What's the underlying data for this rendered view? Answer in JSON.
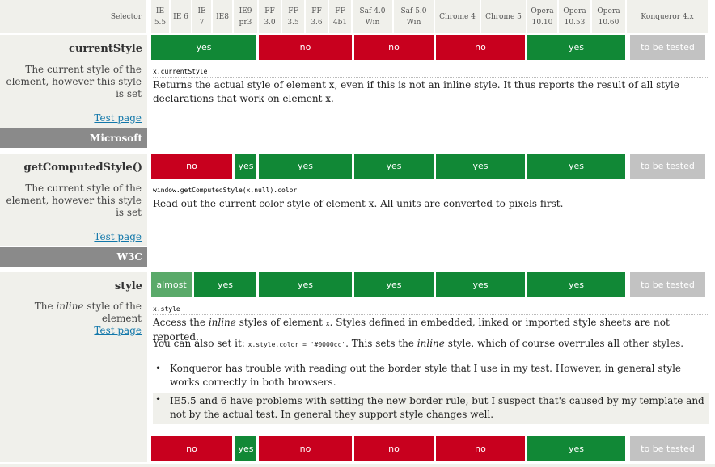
{
  "header": {
    "selector": "Selector",
    "columns": [
      "IE\n5.5",
      "IE 6",
      "IE\n7",
      "IE8",
      "IE9\npr3",
      "FF\n3.0",
      "FF\n3.5",
      "FF\n3.6",
      "FF\n4b1",
      "Saf 4.0\nWin",
      "Saf 5.0\nWin",
      "Chrome 4",
      "Chrome 5",
      "Opera\n10.10",
      "Opera\n10.53",
      "Opera\n10.60",
      "Konqueror 4.x"
    ]
  },
  "rows": {
    "currentStyle": {
      "name": "currentStyle",
      "desc": "The current style of the element, however this style is set",
      "test": "Test page",
      "code": "x.currentStyle",
      "text": "Returns the actual style of element x, even if this is not an inline style. It thus reports the result of all style declarations that work on element x.",
      "results": [
        "yes",
        "no",
        "no",
        "no",
        "yes",
        "to be tested"
      ]
    },
    "group1": "Microsoft",
    "getComputedStyle": {
      "name": "getComputedStyle()",
      "desc": "The current style of the element, however this style is set",
      "test": "Test page",
      "code": "window.getComputedStyle(x,null).color",
      "text": "Read out the current color style of element x. All units are converted to pixels first.",
      "results": [
        "no",
        "yes",
        "yes",
        "yes",
        "yes",
        "yes",
        "to be tested"
      ]
    },
    "group2": "W3C",
    "style": {
      "name": "style",
      "desc_pre": "The ",
      "desc_em": "inline",
      "desc_post": " style of the element",
      "test": "Test page",
      "code": "x.style",
      "text1_a": "Access the ",
      "text1_em": "inline",
      "text1_b": " styles of element ",
      "text1_code": "x",
      "text1_c": ". Styles defined in embedded, linked or imported style sheets are not reported.",
      "text2_a": "You can also set it: ",
      "text2_code": "x.style.color = '#0000cc'",
      "text2_b": ". This sets the ",
      "text2_em": "inline",
      "text2_c": " style, which of course overrules all other styles.",
      "bullet1_a": "Konqueror has trouble with reading out the ",
      "bullet1_code": "border",
      "bullet1_b": " style that I use in my test. However, in general ",
      "bullet1_code2": "style",
      "bullet1_c": " works correctly in both browsers.",
      "bullet2_a": "IE5.5 and 6 have problems with setting the new ",
      "bullet2_code": "border",
      "bullet2_b": " rule, but I suspect that's caused by my template and not by the actual test. In general they support ",
      "bullet2_code2": "style",
      "bullet2_c": " changes well.",
      "results": [
        "almost",
        "yes",
        "yes",
        "yes",
        "yes",
        "yes",
        "to be tested"
      ],
      "results_set": [
        "no",
        "yes",
        "no",
        "no",
        "no",
        "yes",
        "to be tested"
      ]
    }
  },
  "colors": {
    "yes": "#118836",
    "no": "#c8001e",
    "almost": "#5aaa6a",
    "untested": "#c2c2c2",
    "sidebar": "#f0f0eb",
    "group": "#8a8a8a",
    "link": "#1177aa"
  }
}
